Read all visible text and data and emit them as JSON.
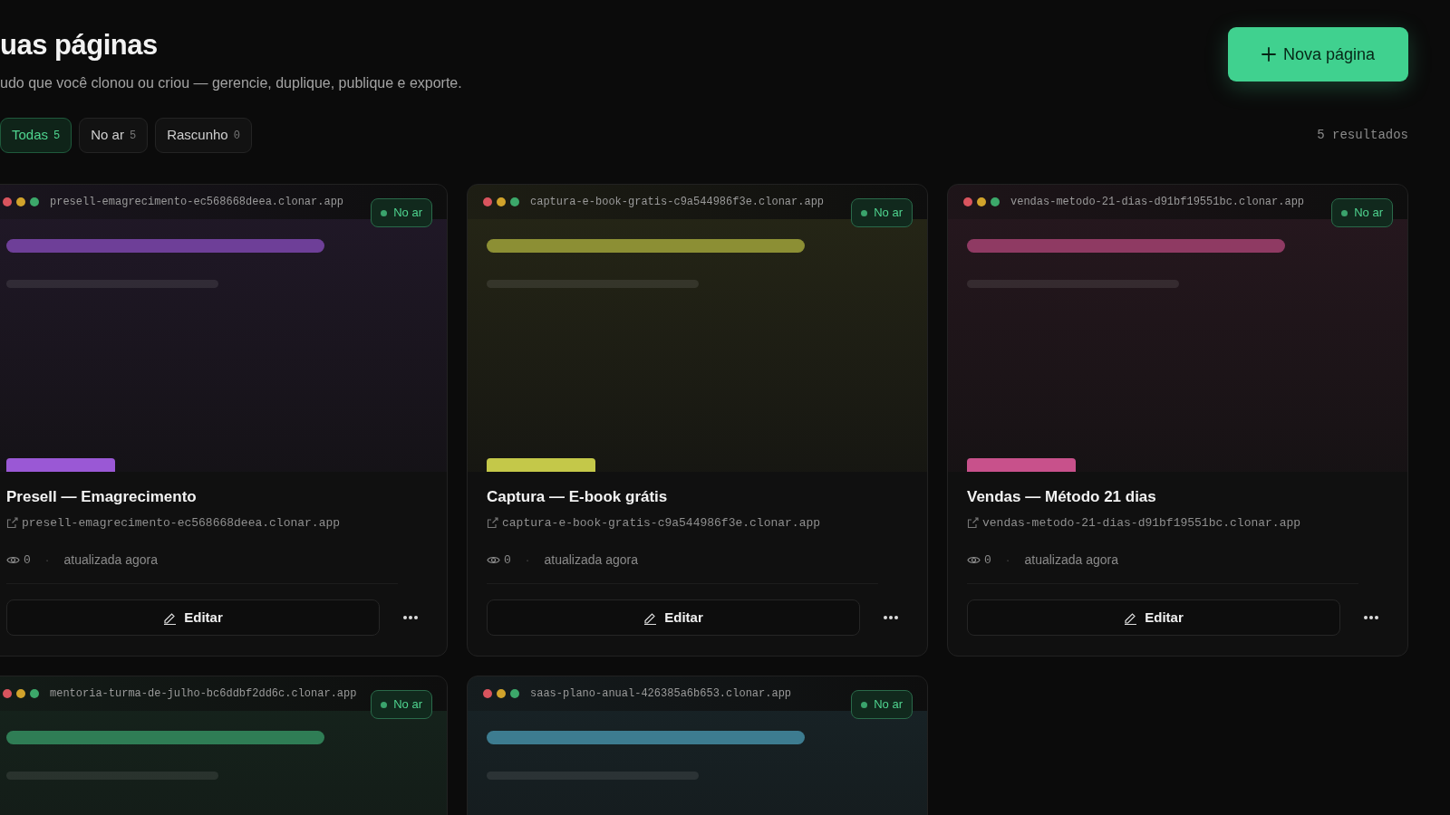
{
  "header": {
    "title": "uas páginas",
    "subtitle": "udo que você clonou ou criou — gerencie, duplique, publique e exporte."
  },
  "new_button": {
    "label": "Nova página"
  },
  "filters": [
    {
      "label": "Todas",
      "count": "5",
      "selected": true
    },
    {
      "label": "No ar",
      "count": "5",
      "selected": false
    },
    {
      "label": "Rascunho",
      "count": "0",
      "selected": false
    }
  ],
  "results": "5 resultados",
  "pages": [
    {
      "domain": "presell-emagrecimento-ec568668deea.clonar.app",
      "status": "No ar",
      "color": "#6e3f98",
      "title": "Presell — Emagrecimento",
      "link": "presell-emagrecimento-ec568668deea.clonar.app",
      "views": "0",
      "separator": "·",
      "updated": "atualizada agora",
      "edit": "Editar"
    },
    {
      "domain": "captura-e-book-gratis-c9a544986f3e.clonar.app",
      "status": "No ar",
      "color": "#8c8f34",
      "title": "Captura — E-book grátis",
      "link": "captura-e-book-gratis-c9a544986f3e.clonar.app",
      "views": "0",
      "separator": "·",
      "updated": "atualizada agora",
      "edit": "Editar"
    },
    {
      "domain": "vendas-metodo-21-dias-d91bf19551bc.clonar.app",
      "status": "No ar",
      "color": "#8f3a63",
      "title": "Vendas — Método 21 dias",
      "link": "vendas-metodo-21-dias-d91bf19551bc.clonar.app",
      "views": "0",
      "separator": "·",
      "updated": "atualizada agora",
      "edit": "Editar"
    },
    {
      "domain": "mentoria-turma-de-julho-bc6ddbf2dd6c.clonar.app",
      "status": "No ar",
      "color": "#2f7d55"
    },
    {
      "domain": "saas-plano-anual-426385a6b653.clonar.app",
      "status": "No ar",
      "color": "#3d7c90"
    }
  ]
}
